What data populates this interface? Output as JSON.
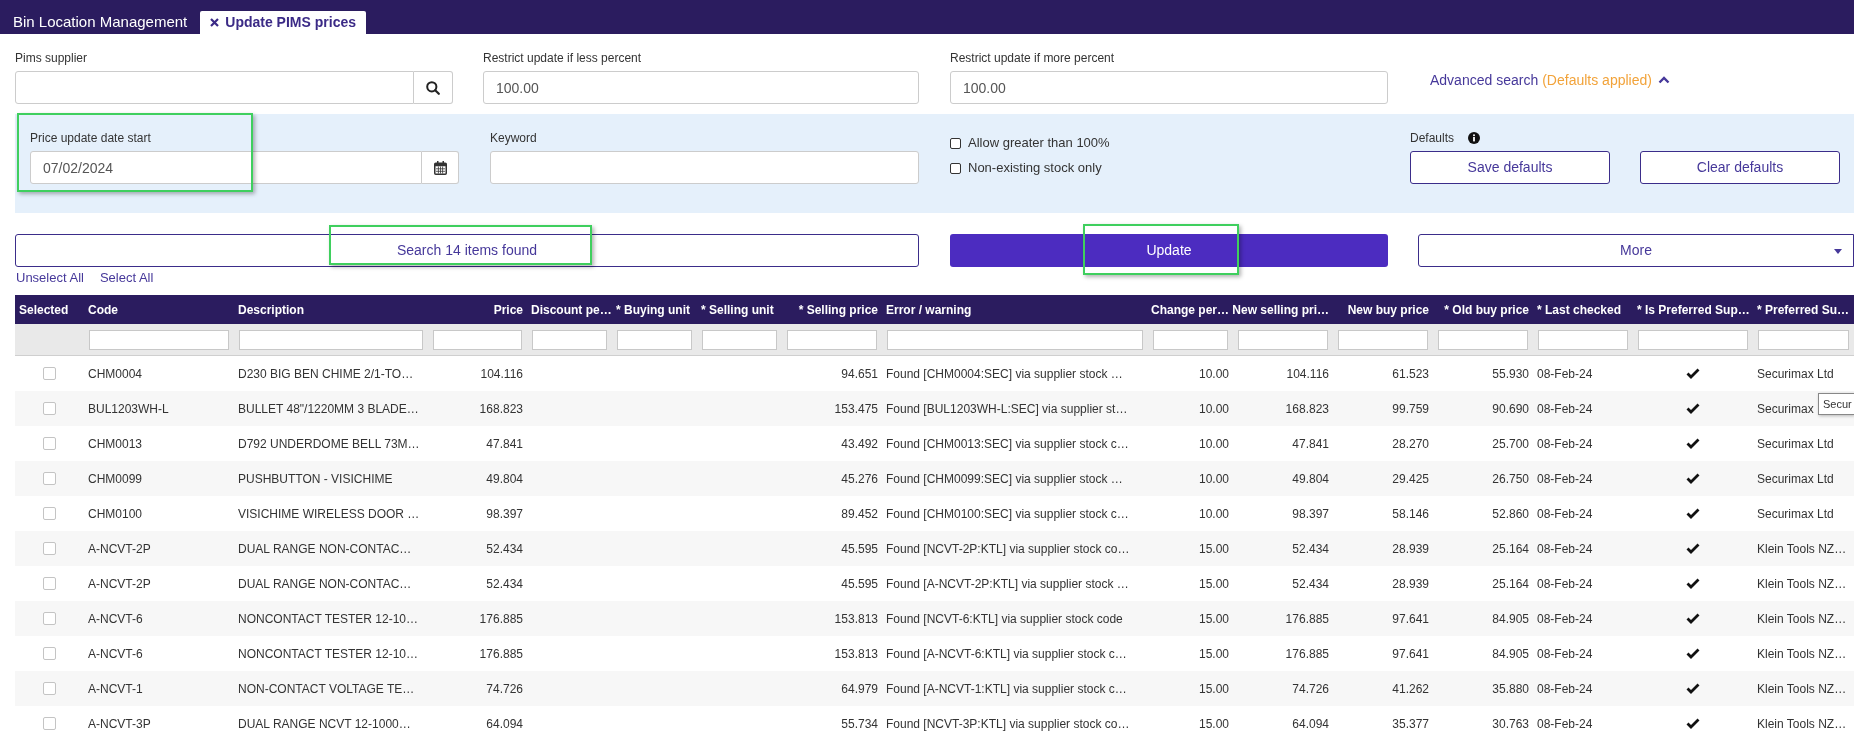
{
  "tabs": [
    {
      "label": "Bin Location Management",
      "selected": false,
      "closable": false
    },
    {
      "label": "Update PIMS prices",
      "selected": true,
      "closable": true
    }
  ],
  "fields": [
    {
      "kind": "lookup",
      "label": "Pims supplier"
    },
    {
      "kind": "text",
      "label": "Restrict update if less percent",
      "value": "100.00"
    },
    {
      "kind": "text",
      "label": "Restrict update if more percent",
      "value": "100.00"
    }
  ],
  "advanced_search": {
    "label": "Advanced search",
    "note": "(Defaults applied)",
    "expanded": true
  },
  "advanced_panel": {
    "fields": [
      {
        "kind": "date",
        "label": "Price update date start",
        "value": "07/02/2024",
        "highlighted": true
      },
      {
        "kind": "text",
        "label": "Keyword"
      }
    ],
    "options": [
      {
        "label": "Allow greater than 100%",
        "checked": false
      },
      {
        "label": "Non-existing stock only",
        "checked": false
      }
    ],
    "defaults": {
      "label": "Defaults",
      "buttons": [
        "Save defaults",
        "Clear defaults"
      ]
    }
  },
  "actions": [
    {
      "kind": "search",
      "label": "Search 14 items found",
      "highlighted": true
    },
    {
      "kind": "primary",
      "label": "Update",
      "highlighted": true
    },
    {
      "kind": "menu",
      "label": "More"
    }
  ],
  "selection_links": [
    "Unselect All",
    "Select All"
  ],
  "table": {
    "columns": [
      "Selected",
      "Code",
      "Description",
      "Price",
      "Discount pe…",
      "* Buying unit",
      "* Selling unit",
      "* Selling price",
      "Error / warning",
      "Change per…",
      "New selling pri…",
      "New buy price",
      "* Old buy price",
      "* Last checked",
      "* Is Preferred Sup…",
      "* Preferred Su…"
    ],
    "rows": [
      {
        "selected": false,
        "code": "CHM0004",
        "description": "D230 BIG BEN CHIME 2/1-TO…",
        "price": "104.116",
        "selling_price": "94.651",
        "error_warning": "Found [CHM0004:SEC] via supplier stock …",
        "change_percent": "10.00",
        "new_selling_price": "104.116",
        "new_buy_price": "61.523",
        "old_buy_price": "55.930",
        "last_checked": "08-Feb-24",
        "is_preferred_supplier": true,
        "preferred_supplier": "Securimax Ltd"
      },
      {
        "selected": false,
        "code": "BUL1203WH-L",
        "description": "BULLET 48\"/1220MM 3 BLADE…",
        "price": "168.823",
        "selling_price": "153.475",
        "error_warning": "Found [BUL1203WH-L:SEC] via supplier st…",
        "change_percent": "10.00",
        "new_selling_price": "168.823",
        "new_buy_price": "99.759",
        "old_buy_price": "90.690",
        "last_checked": "08-Feb-24",
        "is_preferred_supplier": true,
        "preferred_supplier": "Securimax"
      },
      {
        "selected": false,
        "code": "CHM0013",
        "description": "D792 UNDERDOME BELL 73M…",
        "price": "47.841",
        "selling_price": "43.492",
        "error_warning": "Found [CHM0013:SEC] via supplier stock c…",
        "change_percent": "10.00",
        "new_selling_price": "47.841",
        "new_buy_price": "28.270",
        "old_buy_price": "25.700",
        "last_checked": "08-Feb-24",
        "is_preferred_supplier": true,
        "preferred_supplier": "Securimax Ltd"
      },
      {
        "selected": false,
        "code": "CHM0099",
        "description": "PUSHBUTTON - VISICHIME",
        "price": "49.804",
        "selling_price": "45.276",
        "error_warning": "Found [CHM0099:SEC] via supplier stock …",
        "change_percent": "10.00",
        "new_selling_price": "49.804",
        "new_buy_price": "29.425",
        "old_buy_price": "26.750",
        "last_checked": "08-Feb-24",
        "is_preferred_supplier": true,
        "preferred_supplier": "Securimax Ltd"
      },
      {
        "selected": false,
        "code": "CHM0100",
        "description": "VISICHIME WIRELESS DOOR …",
        "price": "98.397",
        "selling_price": "89.452",
        "error_warning": "Found [CHM0100:SEC] via supplier stock c…",
        "change_percent": "10.00",
        "new_selling_price": "98.397",
        "new_buy_price": "58.146",
        "old_buy_price": "52.860",
        "last_checked": "08-Feb-24",
        "is_preferred_supplier": true,
        "preferred_supplier": "Securimax Ltd"
      },
      {
        "selected": false,
        "code": "A-NCVT-2P",
        "description": "DUAL RANGE NON-CONTAC…",
        "price": "52.434",
        "selling_price": "45.595",
        "error_warning": "Found [NCVT-2P:KTL] via supplier stock co…",
        "change_percent": "15.00",
        "new_selling_price": "52.434",
        "new_buy_price": "28.939",
        "old_buy_price": "25.164",
        "last_checked": "08-Feb-24",
        "is_preferred_supplier": true,
        "preferred_supplier": "Klein Tools NZ…"
      },
      {
        "selected": false,
        "code": "A-NCVT-2P",
        "description": "DUAL RANGE NON-CONTAC…",
        "price": "52.434",
        "selling_price": "45.595",
        "error_warning": "Found [A-NCVT-2P:KTL] via supplier stock …",
        "change_percent": "15.00",
        "new_selling_price": "52.434",
        "new_buy_price": "28.939",
        "old_buy_price": "25.164",
        "last_checked": "08-Feb-24",
        "is_preferred_supplier": true,
        "preferred_supplier": "Klein Tools NZ…"
      },
      {
        "selected": false,
        "code": "A-NCVT-6",
        "description": "NONCONTACT TESTER 12-10…",
        "price": "176.885",
        "selling_price": "153.813",
        "error_warning": "Found [NCVT-6:KTL] via supplier stock code",
        "change_percent": "15.00",
        "new_selling_price": "176.885",
        "new_buy_price": "97.641",
        "old_buy_price": "84.905",
        "last_checked": "08-Feb-24",
        "is_preferred_supplier": true,
        "preferred_supplier": "Klein Tools NZ…"
      },
      {
        "selected": false,
        "code": "A-NCVT-6",
        "description": "NONCONTACT TESTER 12-10…",
        "price": "176.885",
        "selling_price": "153.813",
        "error_warning": "Found [A-NCVT-6:KTL] via supplier stock c…",
        "change_percent": "15.00",
        "new_selling_price": "176.885",
        "new_buy_price": "97.641",
        "old_buy_price": "84.905",
        "last_checked": "08-Feb-24",
        "is_preferred_supplier": true,
        "preferred_supplier": "Klein Tools NZ…"
      },
      {
        "selected": false,
        "code": "A-NCVT-1",
        "description": "NON-CONTACT VOLTAGE TE…",
        "price": "74.726",
        "selling_price": "64.979",
        "error_warning": "Found [A-NCVT-1:KTL] via supplier stock c…",
        "change_percent": "15.00",
        "new_selling_price": "74.726",
        "new_buy_price": "41.262",
        "old_buy_price": "35.880",
        "last_checked": "08-Feb-24",
        "is_preferred_supplier": true,
        "preferred_supplier": "Klein Tools NZ…"
      },
      {
        "selected": false,
        "code": "A-NCVT-3P",
        "description": "DUAL RANGE NCVT 12-1000…",
        "price": "64.094",
        "selling_price": "55.734",
        "error_warning": "Found [NCVT-3P:KTL] via supplier stock co…",
        "change_percent": "15.00",
        "new_selling_price": "64.094",
        "new_buy_price": "35.377",
        "old_buy_price": "30.763",
        "last_checked": "08-Feb-24",
        "is_preferred_supplier": true,
        "preferred_supplier": "Klein Tools NZ…"
      }
    ]
  },
  "tooltip": {
    "text": "Secur"
  }
}
